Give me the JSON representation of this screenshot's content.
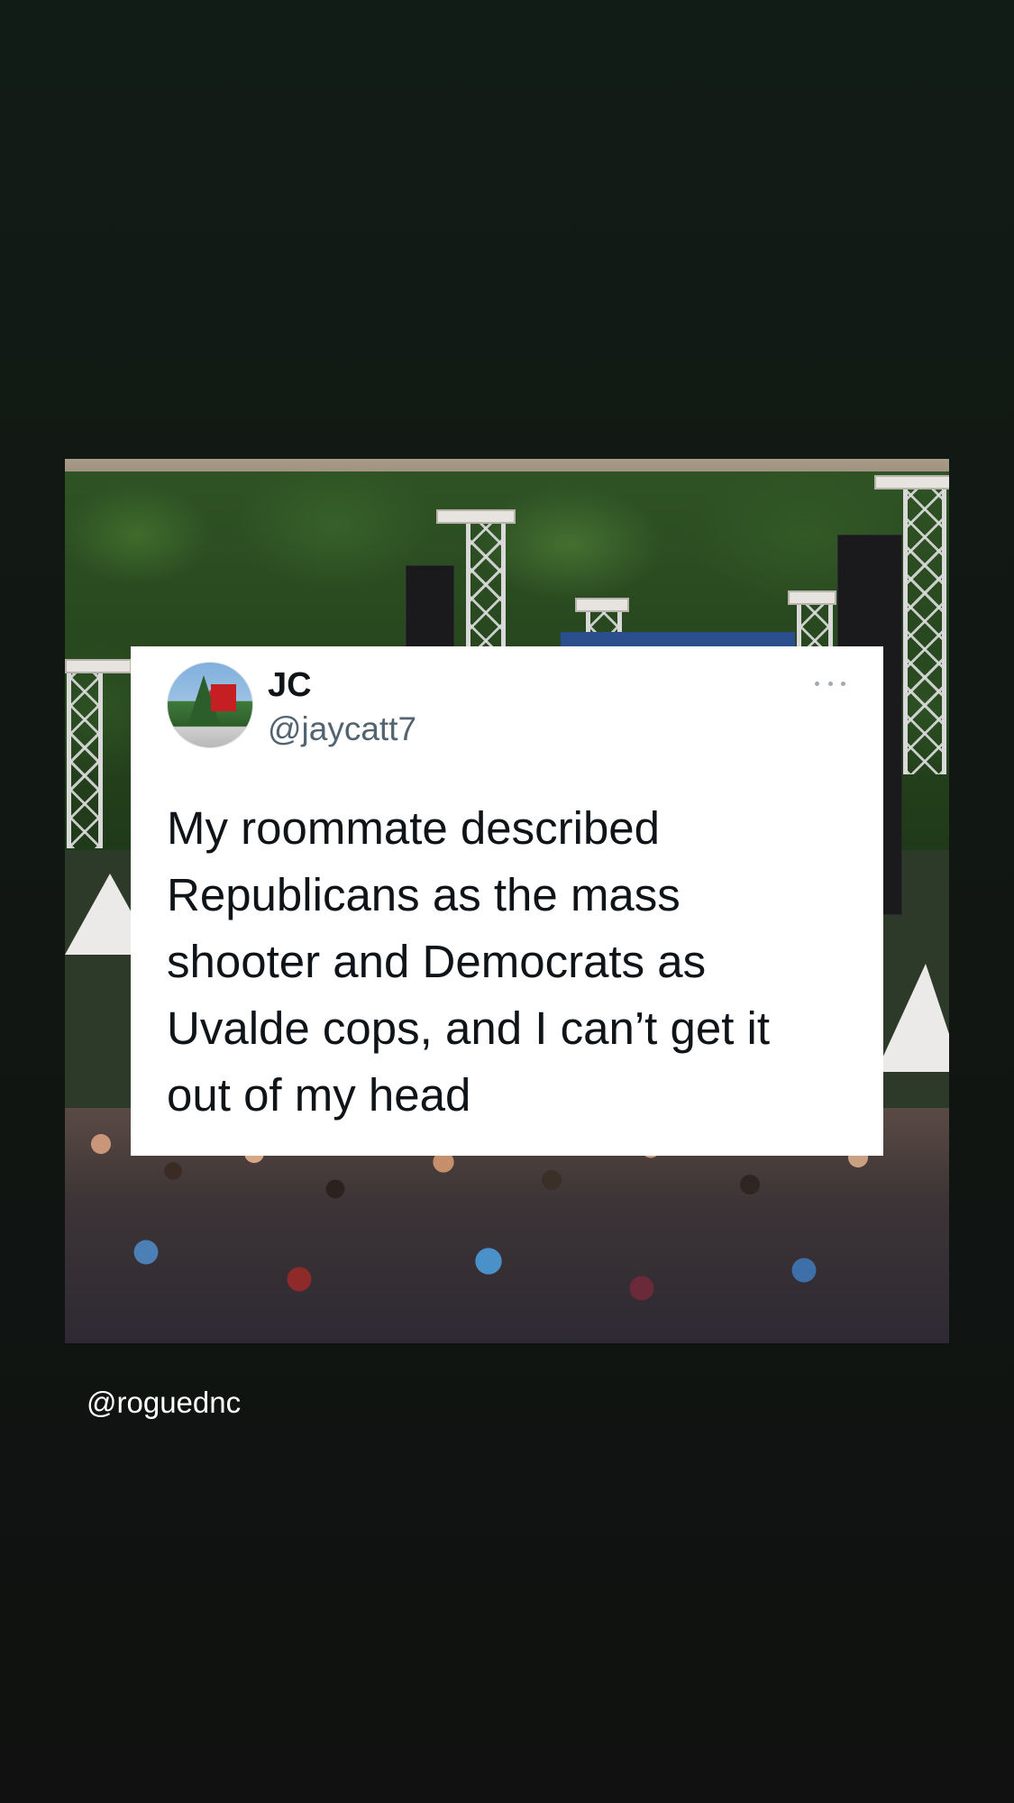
{
  "tweet": {
    "display_name": "JC",
    "handle": "@jaycatt7",
    "text": "My roommate described\nRepublicans as the mass\nshooter and Democrats as\nUvalde cops, and I can’t get it\nout of my head",
    "more_icon": "more-horizontal-icon"
  },
  "story": {
    "credit": "@roguednc"
  },
  "colors": {
    "background": "#111713",
    "card": "#ffffff",
    "text_primary": "#0f1419",
    "text_secondary": "#536471"
  }
}
